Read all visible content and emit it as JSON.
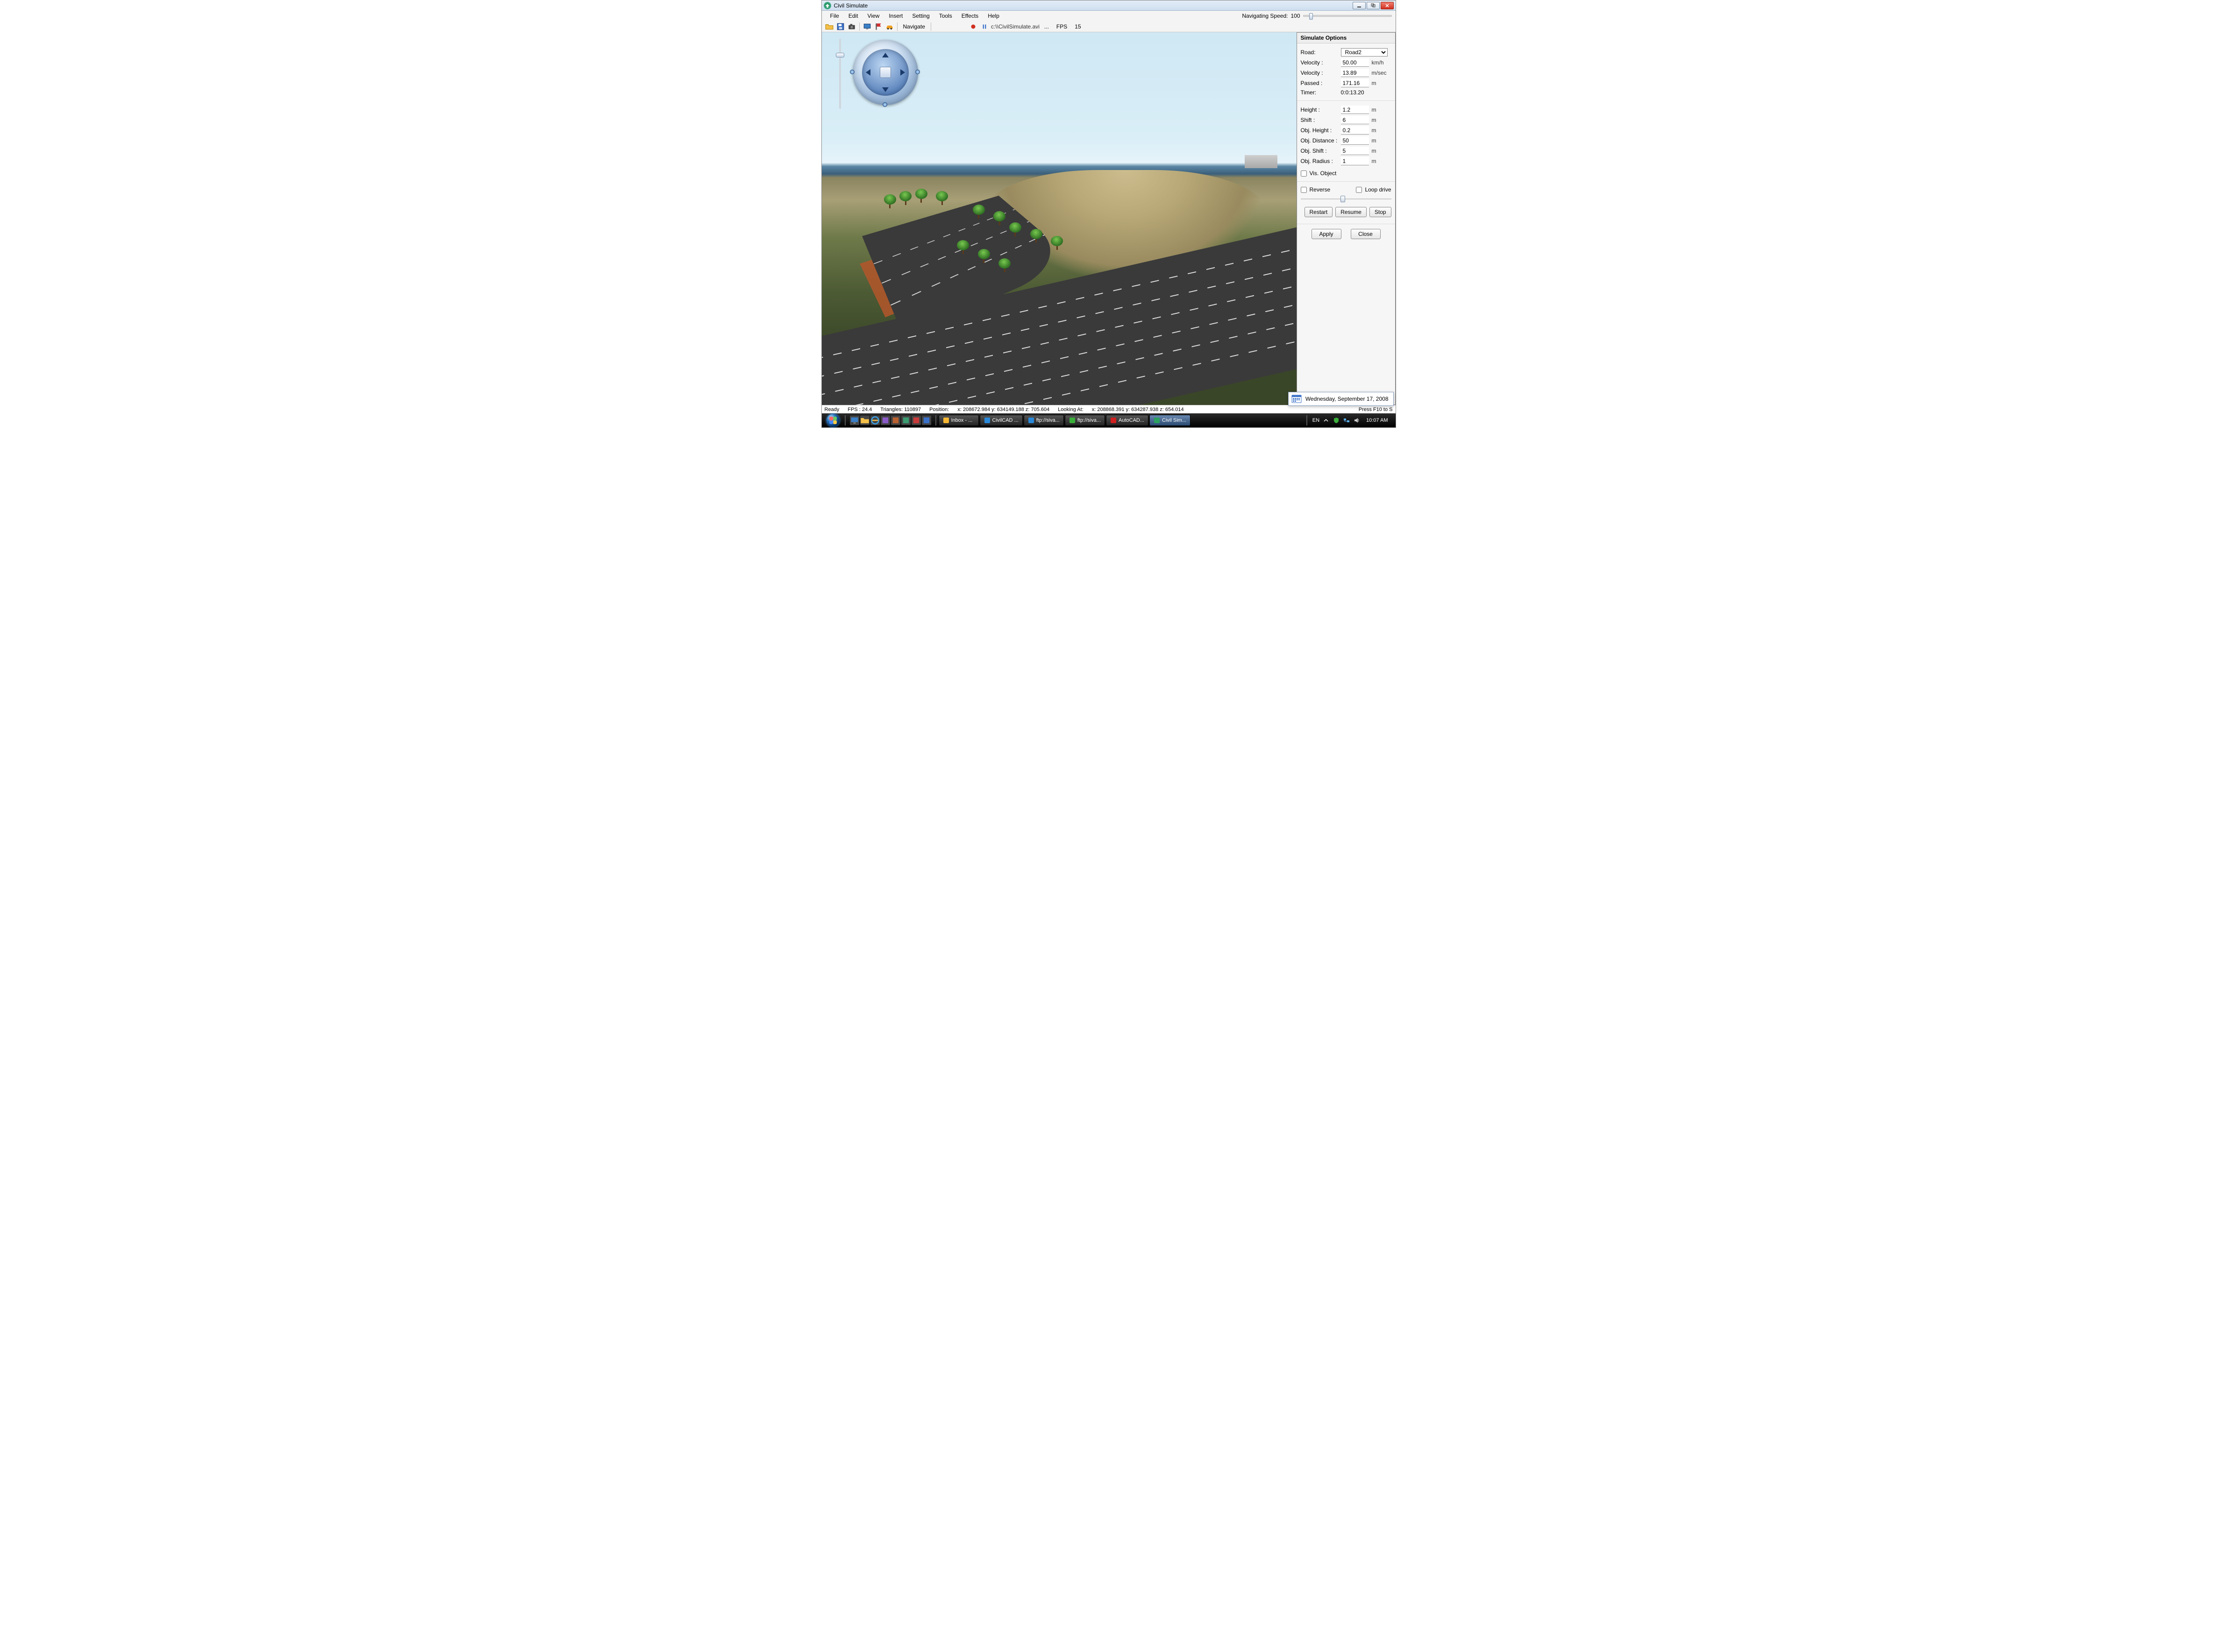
{
  "titlebar": {
    "title": "Civil Simulate"
  },
  "menu": {
    "items": [
      "File",
      "Edit",
      "View",
      "Insert",
      "Setting",
      "Tools",
      "Effects",
      "Help"
    ]
  },
  "navspeed": {
    "label": "Navigating Speed:",
    "value": "100"
  },
  "toolbar": {
    "mode_label": "Navigate",
    "path": "c:\\\\CivilSimulate.avi",
    "ellipsis": "...",
    "fps_label": "FPS",
    "fps_value": "15"
  },
  "panel": {
    "title": "Simulate Options",
    "road": {
      "label": "Road:",
      "value": "Road2"
    },
    "velocity_kmh": {
      "label": "Velocity :",
      "value": "50.00",
      "unit": "km/h"
    },
    "velocity_ms": {
      "label": "Velocity :",
      "value": "13.89",
      "unit": "m/sec"
    },
    "passed": {
      "label": "Passed :",
      "value": "171.16",
      "unit": "m"
    },
    "timer": {
      "label": "Timer:",
      "value": "0:0:13.20"
    },
    "height": {
      "label": "Height :",
      "value": "1.2",
      "unit": "m"
    },
    "shift": {
      "label": "Shift :",
      "value": "6",
      "unit": "m"
    },
    "obj_height": {
      "label": "Obj. Height :",
      "value": "0.2",
      "unit": "m"
    },
    "obj_distance": {
      "label": "Obj. Distance :",
      "value": "50",
      "unit": "m"
    },
    "obj_shift": {
      "label": "Obj. Shift :",
      "value": "5",
      "unit": "m"
    },
    "obj_radius": {
      "label": "Obj. Radius :",
      "value": "1",
      "unit": "m"
    },
    "vis_object": "Vis. Object",
    "reverse": "Reverse",
    "loop": "Loop drive",
    "restart": "Restart",
    "resume": "Resume",
    "stop": "Stop",
    "apply": "Apply",
    "close": "Close"
  },
  "date_popup": {
    "text": "Wednesday, September 17, 2008"
  },
  "status": {
    "ready": "Ready",
    "fps": "FPS : 24.4",
    "tri": "Triangles: 110897",
    "pos_prefix": "Position:",
    "pos": "x: 208672.984  y: 634149.188  z: 705.604",
    "look_prefix": "Looking At:",
    "look": "x: 208868.391  y: 634287.938  z: 654.014",
    "hint": "Press F10 to S"
  },
  "taskbar": {
    "tasks": [
      {
        "label": "Inbox - ...",
        "color": "#f7b733"
      },
      {
        "label": "CivilCAD ...",
        "color": "#2a88d8"
      },
      {
        "label": "ftp://siva...",
        "color": "#2a88d8"
      },
      {
        "label": "ftp://siva...",
        "color": "#3aae3a"
      },
      {
        "label": "AutoCAD...",
        "color": "#d02020"
      },
      {
        "label": "Civil Sim...",
        "color": "#2aa060",
        "active": true
      }
    ],
    "lang": "EN",
    "clock": "10:07 AM"
  }
}
